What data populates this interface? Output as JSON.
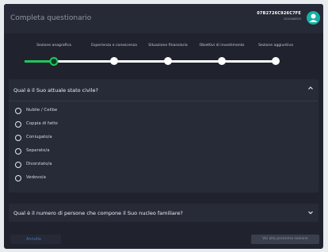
{
  "header": {
    "title": "Completa questionario",
    "user_id": "07B2726C926C7FE",
    "user_sub": "DGGVA8920"
  },
  "stepper": {
    "steps": [
      "Sezione anagrafica",
      "Esperienza e conoscenza",
      "Situazione finanziaria",
      "Obiettivi di investimento",
      "Sezione aggiuntiva"
    ],
    "current_step": 1
  },
  "question1": {
    "title": "Qual è il Suo attuale stato civile?",
    "options": [
      "Nubile / Celibe",
      "Coppia di fatto",
      "Coniugato/a",
      "Separato/a",
      "Divorziato/a",
      "Vedovo/a"
    ]
  },
  "question2": {
    "title": "Qual è il numero di persone che compone il Suo nucleo familiare?"
  },
  "footer": {
    "cancel_label": "Annulla",
    "next_label": "Vai alla prossima sezione"
  },
  "colors": {
    "accent_green": "#22c55e",
    "avatar_teal": "#17b0a6",
    "link_blue": "#4d6fb8"
  }
}
